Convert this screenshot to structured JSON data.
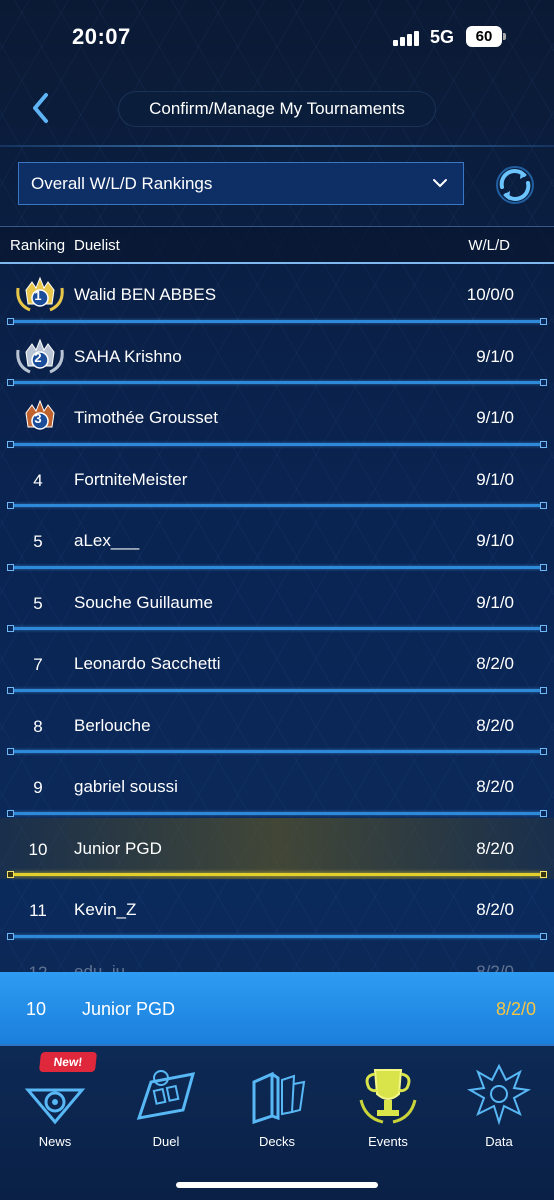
{
  "status_bar": {
    "time": "20:07",
    "network": "5G",
    "battery": "60"
  },
  "header": {
    "title": "Confirm/Manage My Tournaments"
  },
  "filter": {
    "selected": "Overall W/L/D Rankings"
  },
  "columns": {
    "ranking": "Ranking",
    "duelist": "Duelist",
    "wld": "W/L/D"
  },
  "rankings": [
    {
      "rank": "1",
      "name": "Walid BEN ABBES",
      "wld": "10/0/0",
      "medal": "gold"
    },
    {
      "rank": "2",
      "name": "SAHA Krishno",
      "wld": "9/1/0",
      "medal": "silver"
    },
    {
      "rank": "3",
      "name": "Timothée Grousset",
      "wld": "9/1/0",
      "medal": "bronze"
    },
    {
      "rank": "4",
      "name": "FortniteMeister",
      "wld": "9/1/0"
    },
    {
      "rank": "5",
      "name": "aLex___",
      "wld": "9/1/0"
    },
    {
      "rank": "5",
      "name": "Souche Guillaume",
      "wld": "9/1/0"
    },
    {
      "rank": "7",
      "name": "Leonardo Sacchetti",
      "wld": "8/2/0"
    },
    {
      "rank": "8",
      "name": "Berlouche",
      "wld": "8/2/0"
    },
    {
      "rank": "9",
      "name": "gabriel soussi",
      "wld": "8/2/0"
    },
    {
      "rank": "10",
      "name": "Junior PGD",
      "wld": "8/2/0",
      "highlight": true
    },
    {
      "rank": "11",
      "name": "Kevin_Z",
      "wld": "8/2/0"
    },
    {
      "rank": "12",
      "name": "edu_iu",
      "wld": "8/2/0",
      "faded": true
    }
  ],
  "my_rank": {
    "rank": "10",
    "name": "Junior PGD",
    "wld": "8/2/0"
  },
  "nav": {
    "new_badge": "New!",
    "items": [
      {
        "label": "News",
        "icon": "news-icon"
      },
      {
        "label": "Duel",
        "icon": "duel-icon"
      },
      {
        "label": "Decks",
        "icon": "decks-icon"
      },
      {
        "label": "Events",
        "icon": "events-trophy-icon"
      },
      {
        "label": "Data",
        "icon": "data-icon"
      }
    ]
  },
  "colors": {
    "accent": "#2e9cf2",
    "highlight": "#e3cf2c",
    "my_wld": "#f5c542",
    "gold": "#e8c64a",
    "silver": "#b8c4d4",
    "bronze": "#c0622e"
  }
}
